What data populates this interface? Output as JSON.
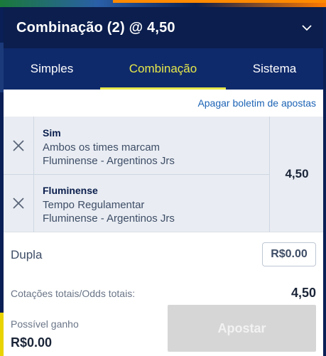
{
  "header": {
    "title": "Combinação (2) @ 4,50",
    "chevron": "chevron-down-icon"
  },
  "tabs": [
    {
      "label": "Simples",
      "active": false
    },
    {
      "label": "Combinação",
      "active": true
    },
    {
      "label": "Sistema",
      "active": false
    }
  ],
  "clear_link": "Apagar boletim de apostas",
  "legs": [
    {
      "selection": "Sim",
      "market": "Ambos os times marcam",
      "event": "Fluminense - Argentinos Jrs"
    },
    {
      "selection": "Fluminense",
      "market": "Tempo Regulamentar",
      "event": "Fluminense - Argentinos Jrs"
    }
  ],
  "combined_odds": "4,50",
  "stake": {
    "label": "Dupla",
    "value": "R$0.00"
  },
  "totals": {
    "label": "Cotações totais/Odds totais:",
    "value": "4,50"
  },
  "potential_win": {
    "label": "Possível ganho",
    "value": "R$0.00"
  },
  "bet_button": "Apostar",
  "colors": {
    "header_bg": "#0b1e4d",
    "tabs_bg": "#0f2a6b",
    "active_tab": "#e6e84a",
    "link": "#1c63b5",
    "bet_button_disabled": "#d6d6d6"
  }
}
